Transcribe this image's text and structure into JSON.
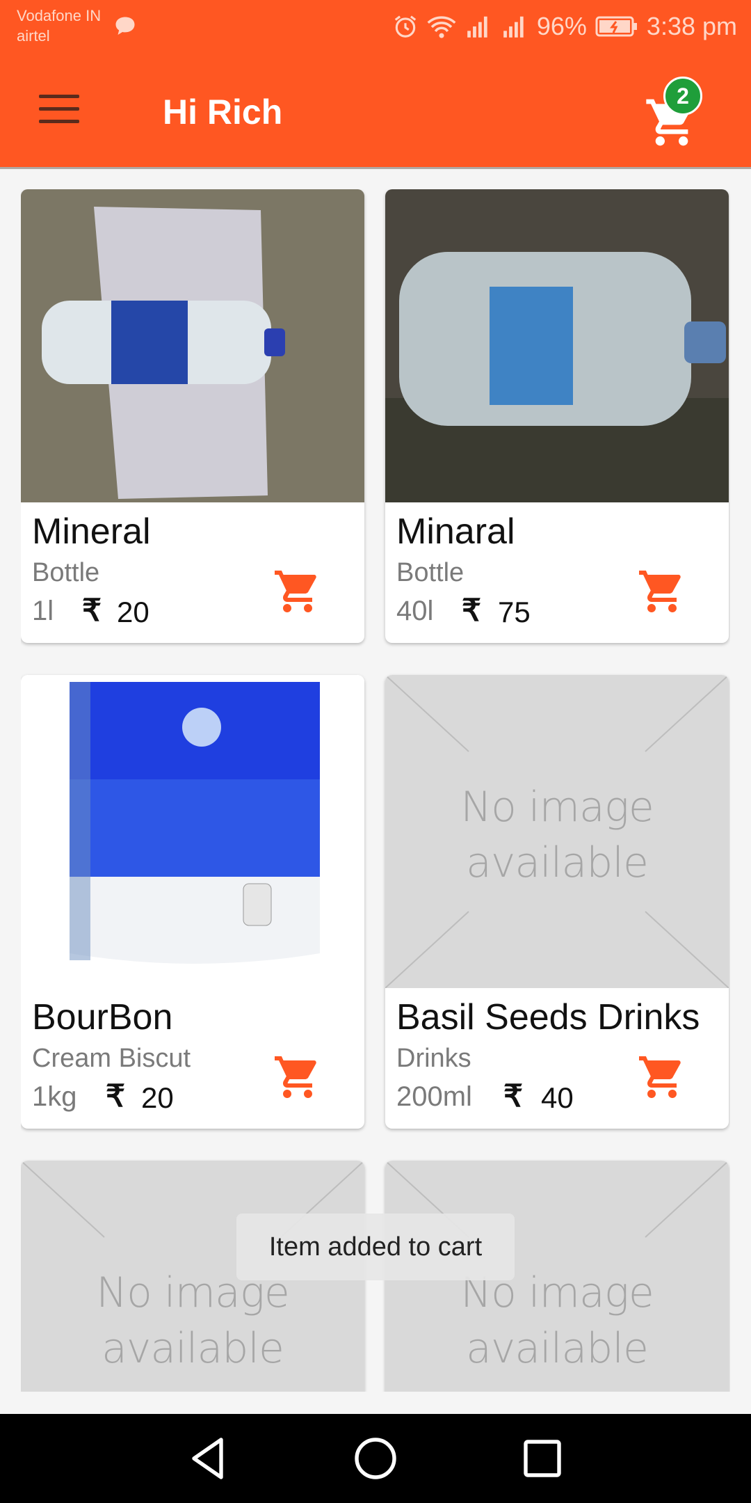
{
  "status_bar": {
    "carrier_1": "Vodafone IN",
    "carrier_2": "airtel",
    "battery": "96%",
    "time": "3:38 pm"
  },
  "app_bar": {
    "title": "Hi Rich",
    "cart_count": "2",
    "icons": [
      "menu-icon",
      "shopping-cart-icon"
    ]
  },
  "products": [
    {
      "name": "Mineral",
      "category": "Bottle",
      "qty": "1l",
      "currency": "₹",
      "price": "20",
      "image": "water-bottle-photo"
    },
    {
      "name": "Minaral",
      "category": "Bottle",
      "qty": "40l",
      "currency": "₹",
      "price": "75",
      "image": "water-can-photo"
    },
    {
      "name": "BourBon",
      "category": "Cream Biscut",
      "qty": "1kg",
      "currency": "₹",
      "price": "20",
      "image": "water-purifier-photo"
    },
    {
      "name": "Basil Seeds Drinks",
      "category": "Drinks",
      "qty": "200ml",
      "currency": "₹",
      "price": "40",
      "image": "placeholder"
    }
  ],
  "placeholder_text": {
    "line1": "No image",
    "line2": "available"
  },
  "toast": "Item added to cart",
  "colors": {
    "primary": "#ff5722",
    "badge": "#1f9e3a",
    "placeholder": "#d9d9d9"
  }
}
